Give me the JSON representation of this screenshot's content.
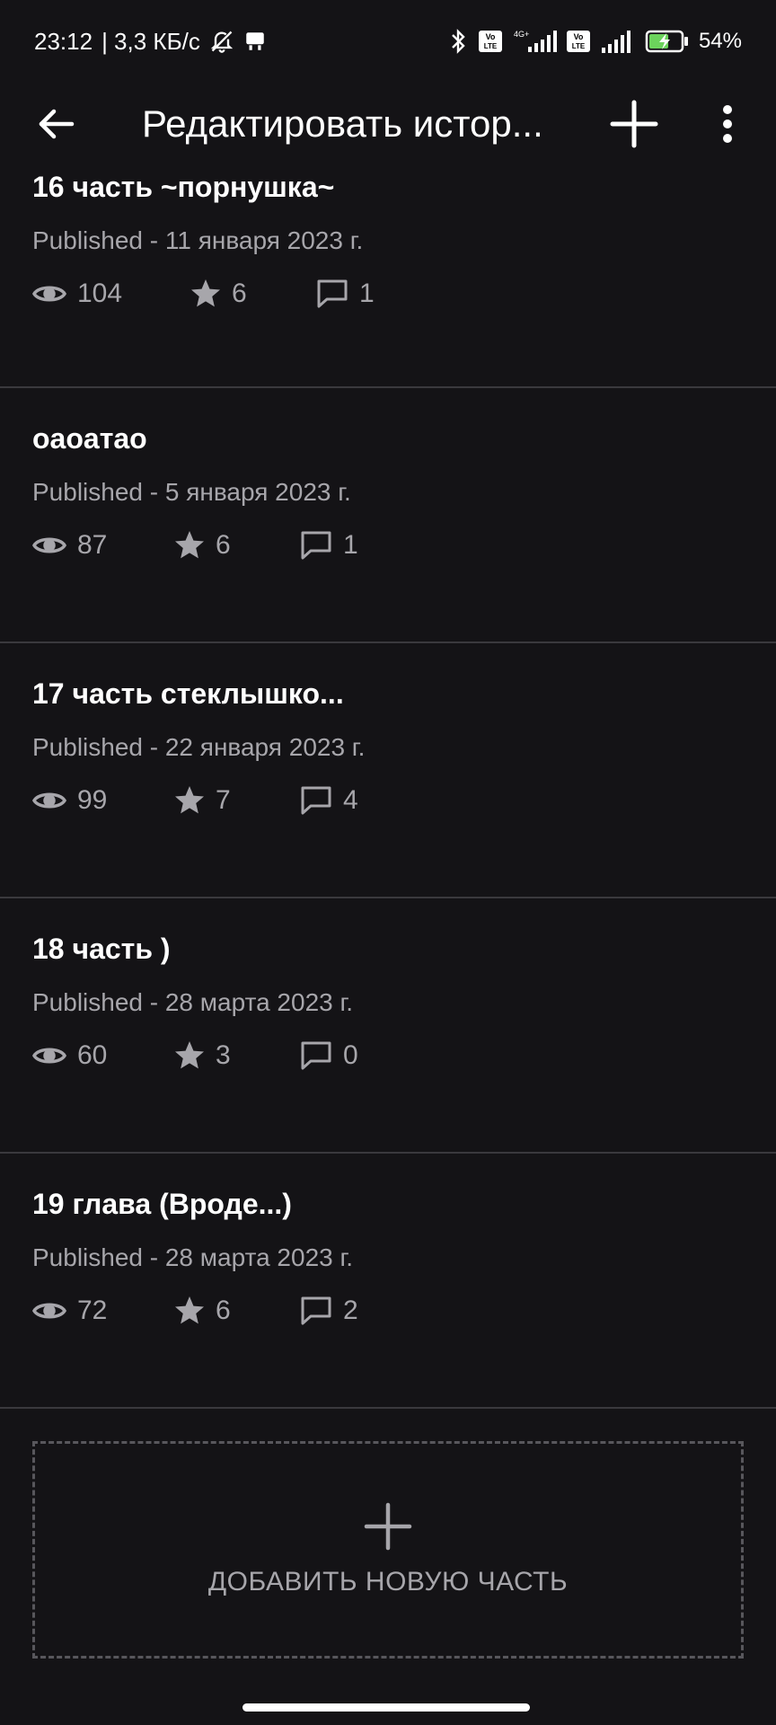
{
  "status_bar": {
    "time": "23:12",
    "speed": "| 3,3 КБ/с",
    "battery": "54%"
  },
  "toolbar": {
    "title": "Редактировать истор..."
  },
  "parts": [
    {
      "title": "16 часть ~порнушка~",
      "date": "Published - 11 января 2023 г.",
      "views": "104",
      "votes": "6",
      "comments": "1"
    },
    {
      "title": "оаоатао",
      "date": "Published - 5 января 2023 г.",
      "views": "87",
      "votes": "6",
      "comments": "1"
    },
    {
      "title": "17 часть стеклышко...",
      "date": "Published - 22 января 2023 г.",
      "views": "99",
      "votes": "7",
      "comments": "4"
    },
    {
      "title": "18 часть )",
      "date": "Published - 28 марта 2023 г.",
      "views": "60",
      "votes": "3",
      "comments": "0"
    },
    {
      "title": "19 глава (Вроде...)",
      "date": "Published - 28 марта 2023 г.",
      "views": "72",
      "votes": "6",
      "comments": "2"
    }
  ],
  "add_part": {
    "label": "ДОБАВИТЬ НОВУЮ ЧАСТЬ"
  },
  "colors": {
    "background": "#141316",
    "muted_text": "#a7a6ab",
    "divider": "#3a393d"
  }
}
